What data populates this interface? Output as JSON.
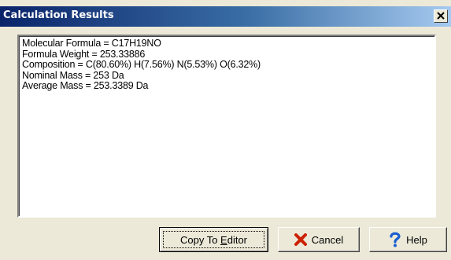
{
  "window": {
    "title": "Calculation Results",
    "close_label": "×"
  },
  "results": {
    "lines": [
      "Molecular Formula = C17H19NO",
      "Formula Weight = 253.33886",
      "Composition =  C(80.60%) H(7.56%) N(5.53%) O(6.32%)",
      "Nominal Mass = 253 Da",
      "Average Mass = 253.3389 Da"
    ]
  },
  "buttons": {
    "copy_prefix": "Copy To ",
    "copy_accel": "E",
    "copy_suffix": "ditor",
    "cancel": "Cancel",
    "help": "Help"
  },
  "icons": {
    "close": "close-icon",
    "cancel": "red-x-icon",
    "help": "question-mark-icon"
  },
  "colors": {
    "titlebar_start": "#0a246a",
    "titlebar_end": "#a6caf0",
    "dialog_bg": "#ece9d8",
    "cancel_icon": "#cc2200",
    "help_icon": "#1a5fd0"
  }
}
